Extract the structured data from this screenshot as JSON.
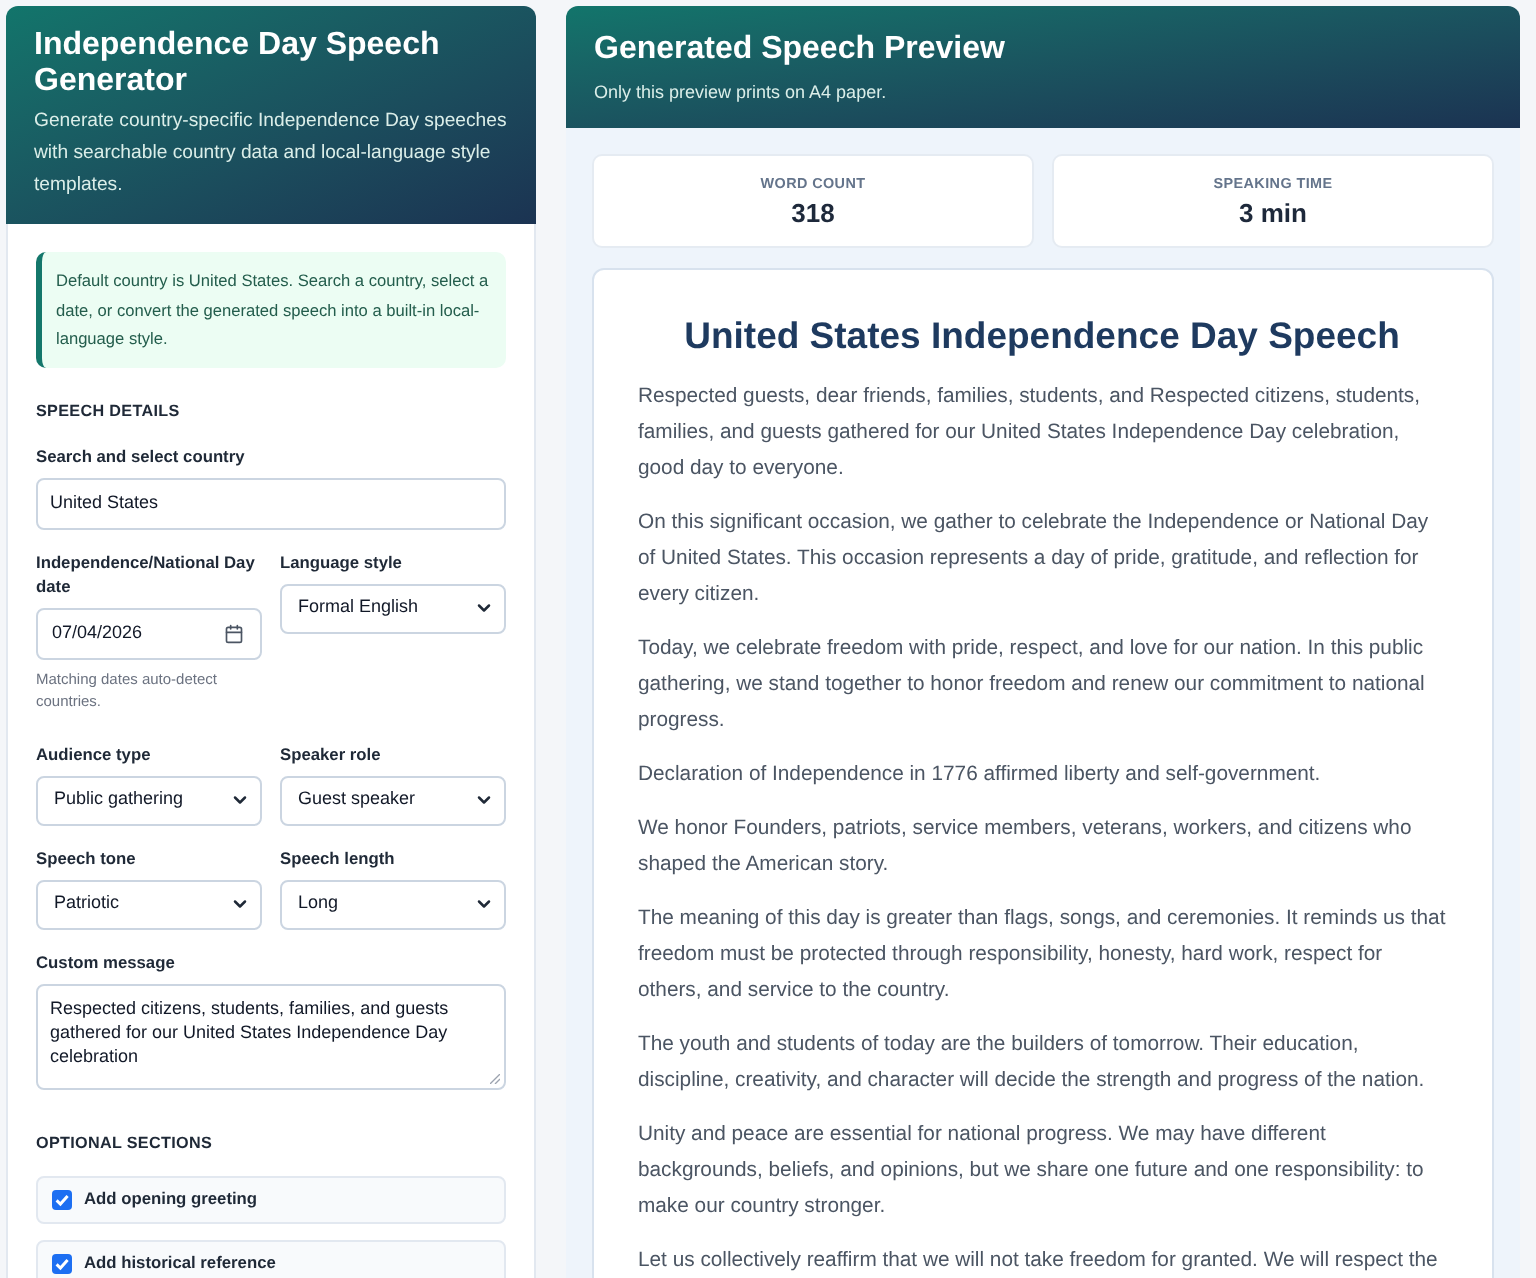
{
  "generator": {
    "title": "Independence Day Speech Generator",
    "subtitle": "Generate country-specific Independence Day speeches with searchable country data and local-language style templates.",
    "notice": "Default country is United States. Search a country, select a date, or convert the generated speech into a built-in local-language style.",
    "details_heading": "SPEECH DETAILS",
    "fields": [
      {
        "kind": "text",
        "label": "Search and select country",
        "value": "United States"
      },
      {
        "kind": "date",
        "label": "Independence/National Day date",
        "value": "07/04/2026",
        "hint": "Matching dates auto-detect countries."
      },
      {
        "kind": "select",
        "label": "Language style",
        "value": "Formal English"
      },
      {
        "kind": "select",
        "label": "Audience type",
        "value": "Public gathering"
      },
      {
        "kind": "select",
        "label": "Speaker role",
        "value": "Guest speaker"
      },
      {
        "kind": "select",
        "label": "Speech tone",
        "value": "Patriotic"
      },
      {
        "kind": "select",
        "label": "Speech length",
        "value": "Long"
      },
      {
        "kind": "textarea",
        "label": "Custom message",
        "value": "Respected citizens, students, families, and guests gathered for our United States Independence Day celebration"
      }
    ],
    "optional_heading": "OPTIONAL SECTIONS",
    "options": [
      {
        "label": "Add opening greeting",
        "checked": true
      },
      {
        "label": "Add historical reference",
        "checked": true
      }
    ]
  },
  "preview": {
    "title": "Generated Speech Preview",
    "subtitle": "Only this preview prints on A4 paper.",
    "stats": [
      {
        "label": "WORD COUNT",
        "value": "318"
      },
      {
        "label": "SPEAKING TIME",
        "value": "3 min"
      }
    ],
    "speech": {
      "title": "United States Independence Day Speech",
      "paragraphs": [
        "Respected guests, dear friends, families, students, and Respected citizens, students, families, and guests gathered for our United States Independence Day celebration, good day to everyone.",
        "On this significant occasion, we gather to celebrate the Independence or National Day of United States. This occasion represents a day of pride, gratitude, and reflection for every citizen.",
        "Today, we celebrate freedom with pride, respect, and love for our nation. In this public gathering, we stand together to honor freedom and renew our commitment to national progress.",
        "Declaration of Independence in 1776 affirmed liberty and self-government.",
        "We honor Founders, patriots, service members, veterans, workers, and citizens who shaped the American story.",
        "The meaning of this day is greater than flags, songs, and ceremonies. It reminds us that freedom must be protected through responsibility, honesty, hard work, respect for others, and service to the country.",
        "The youth and students of today are the builders of tomorrow. Their education, discipline, creativity, and character will decide the strength and progress of the nation.",
        "Unity and peace are essential for national progress. We may have different backgrounds, beliefs, and opinions, but we share one future and one responsibility: to make our country stronger.",
        "Let us collectively reaffirm that we will not take freedom for granted. We will respect the"
      ]
    }
  }
}
